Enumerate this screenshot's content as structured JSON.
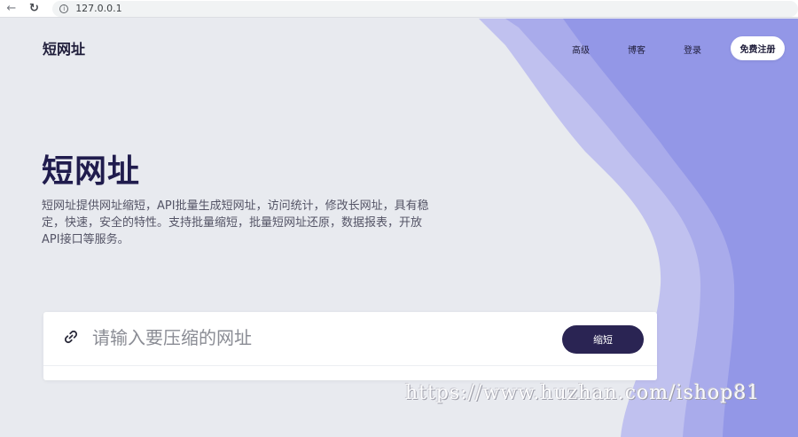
{
  "browser": {
    "url": "127.0.0.1",
    "back_icon": "arrow-left-icon",
    "reload_icon": "reload-icon",
    "info_icon": "info-icon"
  },
  "header": {
    "logo": "短网址",
    "nav": [
      "高级",
      "博客",
      "登录"
    ],
    "signup_label": "免费注册"
  },
  "hero": {
    "title": "短网址",
    "description": "短网址提供网址缩短，API批量生成短网址，访问统计，修改长网址，具有稳定，快速，安全的特性。支持批量缩短，批量短网址还原，数据报表，开放API接口等服务。"
  },
  "shorten": {
    "placeholder": "请输入要压缩的网址",
    "button_label": "缩短",
    "icon": "link-icon"
  },
  "watermark": "https://www.huzhan.com/ishop81",
  "colors": {
    "accent": "#2a2453",
    "title": "#201c4d",
    "wave_light": "#bfc0ee",
    "wave_dark": "#9396e6"
  }
}
